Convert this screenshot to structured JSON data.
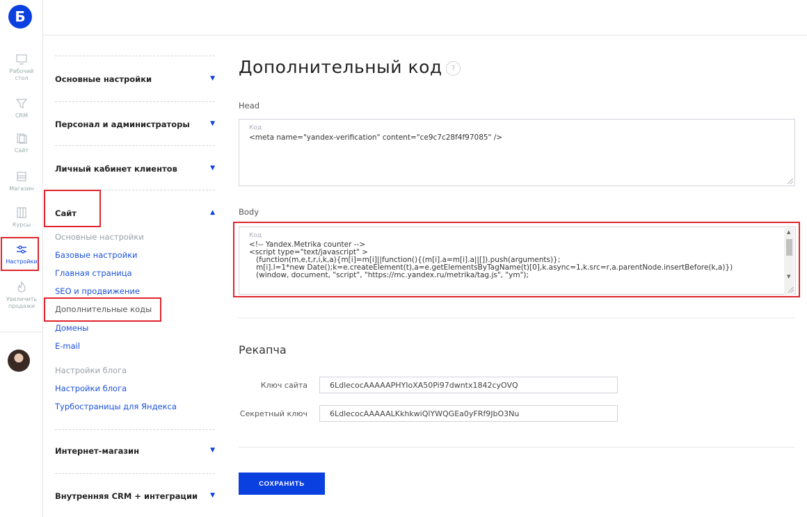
{
  "logo": {
    "glyph": "Б"
  },
  "rail": {
    "items": [
      {
        "label": "Рабочий стол",
        "icon": "monitor-icon"
      },
      {
        "label": "CRM",
        "icon": "funnel-icon"
      },
      {
        "label": "Сайт",
        "icon": "pages-icon"
      },
      {
        "label": "Магазин",
        "icon": "store-icon"
      },
      {
        "label": "Курсы",
        "icon": "book-icon"
      },
      {
        "label": "Настройки",
        "icon": "sliders-icon"
      },
      {
        "label": "Увеличить продажи",
        "icon": "flame-icon"
      }
    ]
  },
  "menu": {
    "sections": [
      {
        "label": "Основные настройки"
      },
      {
        "label": "Персонал и администраторы"
      },
      {
        "label": "Личный кабинет клиентов"
      },
      {
        "label": "Сайт"
      },
      {
        "label": "Интернет-магазин"
      },
      {
        "label": "Внутренняя CRM + интеграции"
      }
    ],
    "site_items": [
      "Основные настройки",
      "Базовые настройки",
      "Главная страница",
      "SEO и продвижение",
      "Дополнительные коды",
      "Домены",
      "E-mail",
      "Настройки блога",
      "Настройки блога",
      "Турбостраницы для Яндекса"
    ]
  },
  "main": {
    "title": "Дополнительный код",
    "help": "?",
    "head_label": "Head",
    "head_placeholder": "Код",
    "head_code": "<meta name=\"yandex-verification\" content=\"ce9c7c28f4f97085\" />",
    "body_label": "Body",
    "body_placeholder": "Код",
    "body_code": [
      "<!-- Yandex.Metrika counter -->",
      "<script type=\"text/javascript\" >",
      "   (function(m,e,t,r,i,k,a){m[i]=m[i]||function(){(m[i].a=m[i].a||[]).push(arguments)};",
      "   m[i].l=1*new Date();k=e.createElement(t),a=e.getElementsByTagName(t)[0],k.async=1,k.src=r,a.parentNode.insertBefore(k,a)})",
      "   (window, document, \"script\", \"https://mc.yandex.ru/metrika/tag.js\", \"ym\");"
    ],
    "captcha_title": "Рекапча",
    "site_key_label": "Ключ сайта",
    "site_key_value": "6LdlecocAAAAAPHYIoXA50Pi97dwntx1842cyOVQ",
    "secret_key_label": "Секретный ключ",
    "secret_key_value": "6LdlecocAAAAALKkhkwiQlYWQGEa0yFRf9JbO3Nu",
    "save_label": "СОХРАНИТЬ"
  },
  "colors": {
    "accent": "#0a3fe0",
    "highlight": "#e0232c"
  }
}
